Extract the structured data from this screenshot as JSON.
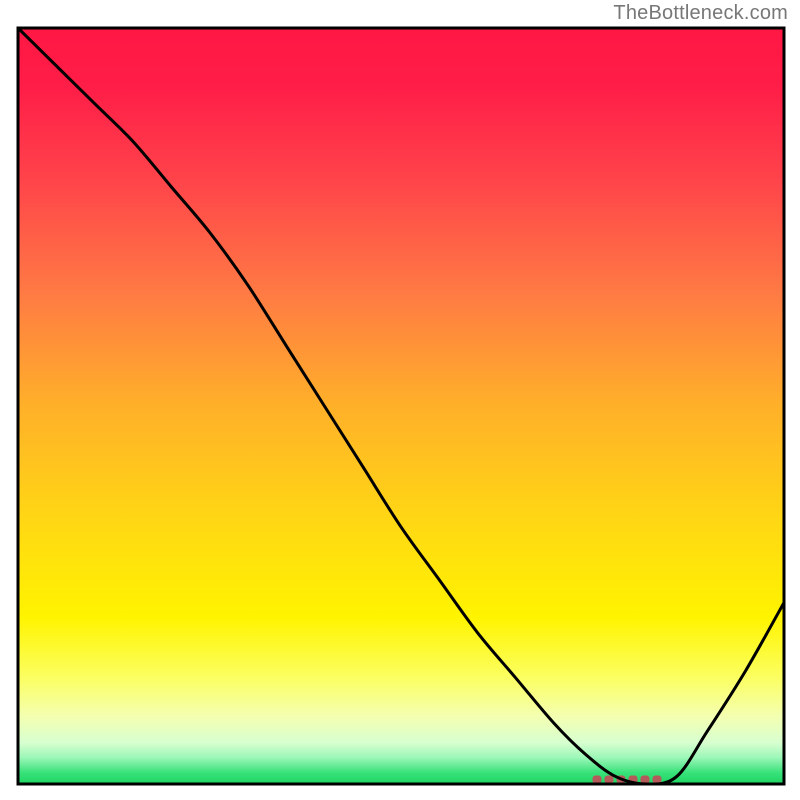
{
  "attribution": "TheBottleneck.com",
  "colors": {
    "gradient_stops": [
      {
        "offset": 0.0,
        "color": "#ff1744"
      },
      {
        "offset": 0.08,
        "color": "#ff1e48"
      },
      {
        "offset": 0.2,
        "color": "#ff434a"
      },
      {
        "offset": 0.35,
        "color": "#ff7a44"
      },
      {
        "offset": 0.5,
        "color": "#ffb029"
      },
      {
        "offset": 0.65,
        "color": "#ffd714"
      },
      {
        "offset": 0.78,
        "color": "#fff400"
      },
      {
        "offset": 0.86,
        "color": "#fbff62"
      },
      {
        "offset": 0.91,
        "color": "#f4ffb0"
      },
      {
        "offset": 0.945,
        "color": "#d8ffd0"
      },
      {
        "offset": 0.965,
        "color": "#9cf7b8"
      },
      {
        "offset": 0.985,
        "color": "#38e27a"
      },
      {
        "offset": 1.0,
        "color": "#1ed563"
      }
    ],
    "curve_stroke": "#000000",
    "marker_fill": "#b55a5a",
    "frame_stroke": "#000000"
  },
  "chart_data": {
    "type": "line",
    "title": "",
    "xlabel": "",
    "ylabel": "",
    "xlim": [
      0,
      100
    ],
    "ylim": [
      0,
      100
    ],
    "grid": false,
    "legend": "none",
    "series": [
      {
        "name": "bottleneck-curve",
        "x": [
          0,
          5,
          10,
          15,
          20,
          25,
          30,
          35,
          40,
          45,
          50,
          55,
          60,
          65,
          70,
          74,
          78,
          82,
          86,
          90,
          95,
          100
        ],
        "y": [
          100,
          95,
          90,
          85,
          79,
          73,
          66,
          58,
          50,
          42,
          34,
          27,
          20,
          14,
          8,
          4,
          1,
          0,
          1,
          7,
          15,
          24
        ]
      }
    ],
    "annotations": [
      {
        "name": "optimal-region-marker",
        "x_start": 75,
        "x_end": 85,
        "y": 0.6
      }
    ]
  }
}
